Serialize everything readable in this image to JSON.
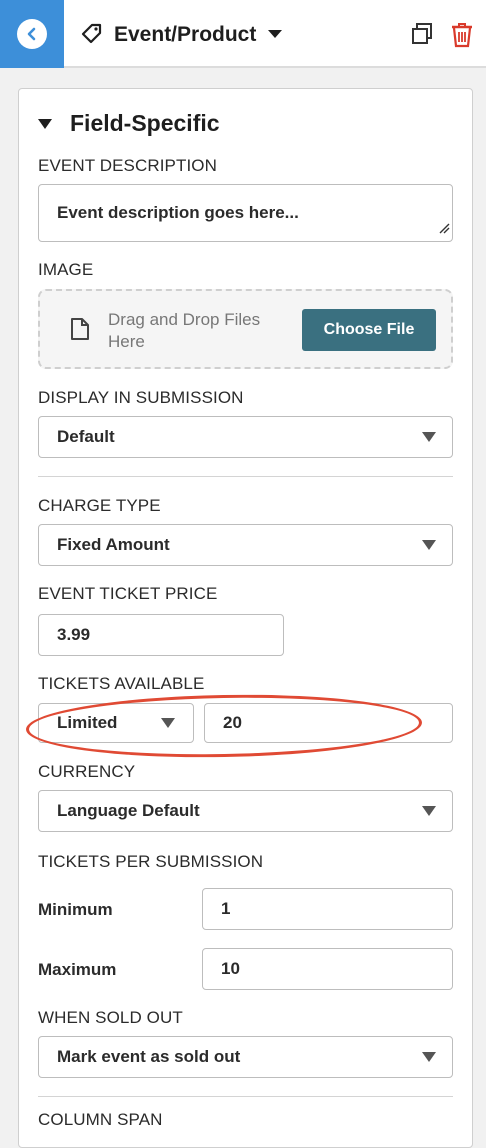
{
  "header": {
    "title": "Event/Product"
  },
  "section": {
    "title": "Field-Specific"
  },
  "event_description": {
    "label": "EVENT DESCRIPTION",
    "value": "Event description goes here..."
  },
  "image": {
    "label": "IMAGE",
    "drop_text": "Drag and Drop Files Here",
    "button_label": "Choose File"
  },
  "display_in_submission": {
    "label": "DISPLAY IN SUBMISSION",
    "value": "Default"
  },
  "charge_type": {
    "label": "CHARGE TYPE",
    "value": "Fixed Amount"
  },
  "event_ticket_price": {
    "label": "EVENT TICKET PRICE",
    "value": "3.99"
  },
  "tickets_available": {
    "label": "TICKETS AVAILABLE",
    "mode": "Limited",
    "value": "20"
  },
  "currency": {
    "label": "CURRENCY",
    "value": "Language Default"
  },
  "tickets_per_submission": {
    "label": "TICKETS PER SUBMISSION",
    "minimum_label": "Minimum",
    "minimum_value": "1",
    "maximum_label": "Maximum",
    "maximum_value": "10"
  },
  "when_sold_out": {
    "label": "WHEN SOLD OUT",
    "value": "Mark event as sold out"
  },
  "column_span": {
    "label": "COLUMN SPAN"
  },
  "colors": {
    "back_button": "#3d8fd9",
    "choose_button": "#3a7080",
    "trash": "#d93a2b",
    "annotation": "#e04a34"
  },
  "icons": {
    "back": "chevron-left-icon",
    "tag": "tag-icon",
    "duplicate": "duplicate-icon",
    "trash": "trash-icon",
    "file": "file-icon"
  }
}
